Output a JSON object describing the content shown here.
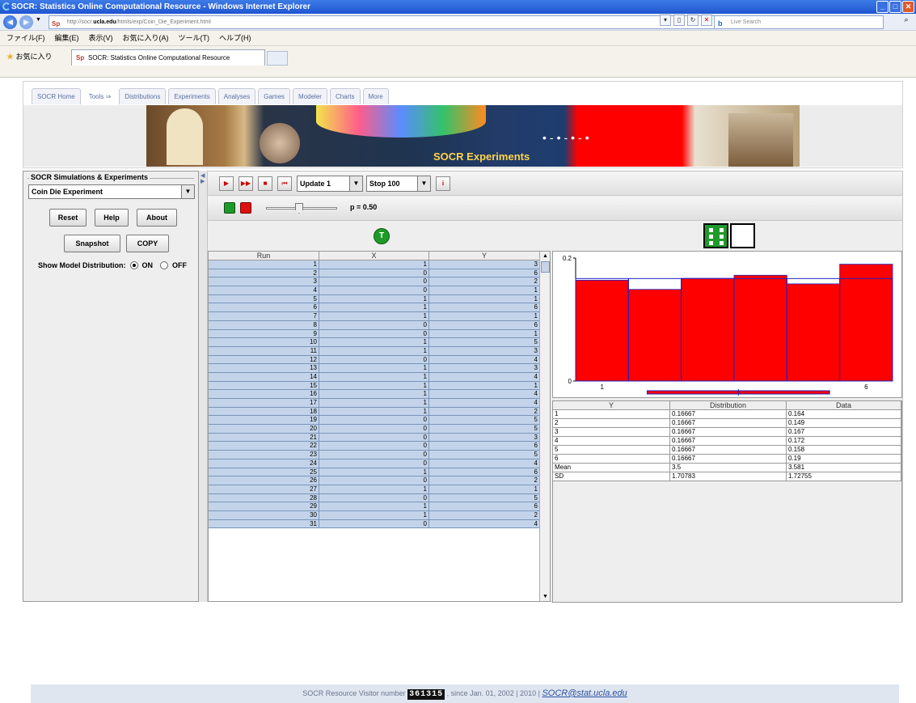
{
  "window": {
    "title": "SOCR: Statistics Online Computational Resource - Windows Internet Explorer"
  },
  "address": {
    "prefix": "http://socr.",
    "domain": "ucla.edu",
    "path": "/htmls/exp/Coin_Die_Experiment.html",
    "search_placeholder": "Live Search"
  },
  "menu": [
    "ファイル(F)",
    "編集(E)",
    "表示(V)",
    "お気に入り(A)",
    "ツール(T)",
    "ヘルプ(H)"
  ],
  "favorites": {
    "label": "お気に入り",
    "tab_title": "SOCR: Statistics Online Computational Resource"
  },
  "nav_tabs": [
    "SOCR Home",
    "Tools ⇒",
    "Distributions",
    "Experiments",
    "Analyses",
    "Games",
    "Modeler",
    "Charts",
    "More"
  ],
  "banner": {
    "title": "SOCR Experiments"
  },
  "left": {
    "group_title": "SOCR Simulations & Experiments",
    "experiment": "Coin Die Experiment",
    "buttons": {
      "reset": "Reset",
      "help": "Help",
      "about": "About",
      "snapshot": "Snapshot",
      "copy": "COPY"
    },
    "model": {
      "label": "Show Model Distribution:",
      "on": "ON",
      "off": "OFF",
      "selected": "ON"
    }
  },
  "toolbar": {
    "update": "Update 1",
    "stop": "Stop 100",
    "info": "i"
  },
  "param": {
    "p_label": "p = 0.50",
    "p": 0.5
  },
  "coin_label": "T",
  "runs_table": {
    "headers": [
      "Run",
      "X",
      "Y"
    ],
    "rows": [
      [
        "1",
        "1",
        "3"
      ],
      [
        "2",
        "0",
        "6"
      ],
      [
        "3",
        "0",
        "2"
      ],
      [
        "4",
        "0",
        "1"
      ],
      [
        "5",
        "1",
        "1"
      ],
      [
        "6",
        "1",
        "6"
      ],
      [
        "7",
        "1",
        "1"
      ],
      [
        "8",
        "0",
        "6"
      ],
      [
        "9",
        "0",
        "1"
      ],
      [
        "10",
        "1",
        "5"
      ],
      [
        "11",
        "1",
        "3"
      ],
      [
        "12",
        "0",
        "4"
      ],
      [
        "13",
        "1",
        "3"
      ],
      [
        "14",
        "1",
        "4"
      ],
      [
        "15",
        "1",
        "1"
      ],
      [
        "16",
        "1",
        "4"
      ],
      [
        "17",
        "1",
        "4"
      ],
      [
        "18",
        "1",
        "2"
      ],
      [
        "19",
        "0",
        "5"
      ],
      [
        "20",
        "0",
        "5"
      ],
      [
        "21",
        "0",
        "3"
      ],
      [
        "22",
        "0",
        "6"
      ],
      [
        "23",
        "0",
        "5"
      ],
      [
        "24",
        "0",
        "4"
      ],
      [
        "25",
        "1",
        "6"
      ],
      [
        "26",
        "0",
        "2"
      ],
      [
        "27",
        "1",
        "1"
      ],
      [
        "28",
        "0",
        "5"
      ],
      [
        "29",
        "1",
        "6"
      ],
      [
        "30",
        "1",
        "2"
      ],
      [
        "31",
        "0",
        "4"
      ]
    ]
  },
  "chart_data": {
    "type": "bar",
    "categories": [
      "1",
      "2",
      "3",
      "4",
      "5",
      "6"
    ],
    "series": [
      {
        "values": [
          0.164,
          0.149,
          0.167,
          0.172,
          0.158,
          0.19
        ]
      },
      {
        "values": [
          0.16667,
          0.16667,
          0.16667,
          0.16667,
          0.16667,
          0.16667
        ]
      }
    ],
    "ylim": [
      0,
      0.2
    ],
    "xlim": [
      0.5,
      6.5
    ],
    "ytick_labels": [
      "0",
      "0.2"
    ],
    "xtick_labels": [
      "1",
      "6"
    ],
    "colors": {
      "data": "#ff0000",
      "model": "#2020c0"
    }
  },
  "dist_table": {
    "headers": [
      "Y",
      "Distribution",
      "Data"
    ],
    "rows": [
      [
        "1",
        "0.16667",
        "0.164"
      ],
      [
        "2",
        "0.16667",
        "0.149"
      ],
      [
        "3",
        "0.16667",
        "0.167"
      ],
      [
        "4",
        "0.16667",
        "0.172"
      ],
      [
        "5",
        "0.16667",
        "0.158"
      ],
      [
        "6",
        "0.16667",
        "0.19"
      ],
      [
        "Mean",
        "3.5",
        "3.581"
      ],
      [
        "SD",
        "1.70783",
        "1.72755"
      ]
    ]
  },
  "footer": {
    "pre": "SOCR Resource Visitor number",
    "count": "361315",
    "post": ", since Jan. 01, 2002 | 2010 |",
    "email": "SOCR@stat.ucla.edu"
  }
}
